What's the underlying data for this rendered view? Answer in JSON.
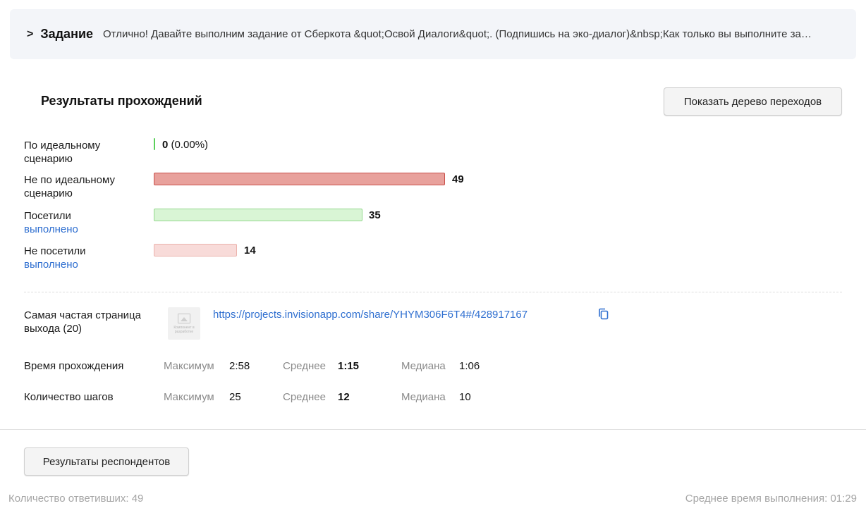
{
  "task": {
    "chevron": ">",
    "title": "Задание",
    "text": "Отлично! Давайте выполним задание от Сберкота &quot;Освой Диалоги&quot;. (Подпишись на эко-диалог)&nbsp;Как только вы выполните задание, нажмите кнопку"
  },
  "results": {
    "title": "Результаты прохождений",
    "tree_button": "Показать дерево переходов",
    "rows": [
      {
        "label": "По идеальному сценарию",
        "value": "0",
        "percent": "(0.00%)",
        "color": "#5bd05b"
      },
      {
        "label": "Не по идеальному сценарию",
        "value": "49",
        "color": "#e8a19c"
      },
      {
        "label": "Посетили",
        "link": "выполнено",
        "value": "35",
        "color": "#d9f5d5"
      },
      {
        "label": "Не посетили",
        "link": "выполнено",
        "value": "14",
        "color": "#f8dbd9"
      }
    ]
  },
  "exit_page": {
    "label": "Самая частая страница выхода (20)",
    "thumb_text": "Компонент в разработке",
    "url": "https://projects.invisionapp.com/share/YHYM306F6T4#/428917167",
    "icon": "copy-icon"
  },
  "time": {
    "label": "Время прохождения",
    "max_label": "Максимум",
    "max": "2:58",
    "avg_label": "Среднее",
    "avg": "1:15",
    "median_label": "Медиана",
    "median": "1:06"
  },
  "steps": {
    "label": "Количество шагов",
    "max_label": "Максимум",
    "max": "25",
    "avg_label": "Среднее",
    "avg": "12",
    "median_label": "Медиана",
    "median": "10"
  },
  "respondents_button": "Результаты респондентов",
  "footer": {
    "responders": "Количество ответивших: 49",
    "avg_time": "Среднее время выполнения: 01:29"
  }
}
